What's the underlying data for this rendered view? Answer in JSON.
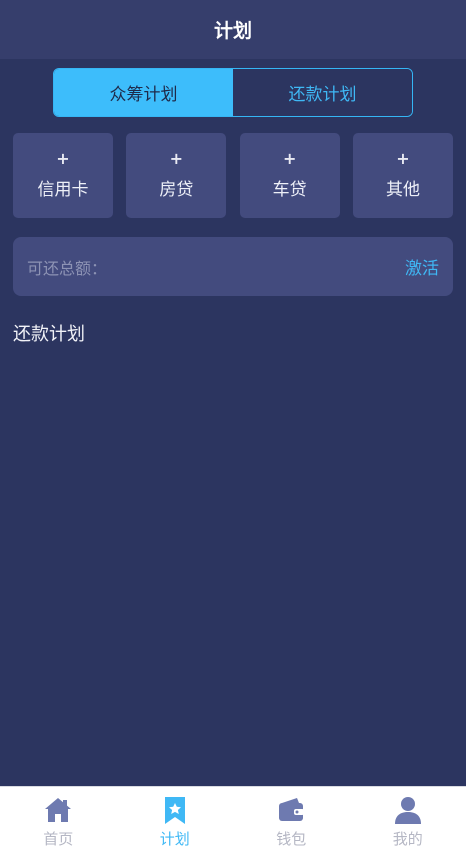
{
  "header": {
    "title": "计划"
  },
  "segment": {
    "tabs": [
      {
        "label": "众筹计划",
        "active": true
      },
      {
        "label": "还款计划",
        "active": false
      }
    ]
  },
  "categories": [
    {
      "plus": "+",
      "label": "信用卡"
    },
    {
      "plus": "+",
      "label": "房贷"
    },
    {
      "plus": "+",
      "label": "车贷"
    },
    {
      "plus": "+",
      "label": "其他"
    }
  ],
  "total": {
    "label": "可还总额：",
    "action": "激活"
  },
  "section": {
    "title": "还款计划"
  },
  "tabbar": {
    "items": [
      {
        "label": "首页",
        "icon": "home-icon",
        "active": false
      },
      {
        "label": "计划",
        "icon": "bookmark-star-icon",
        "active": true
      },
      {
        "label": "钱包",
        "icon": "wallet-icon",
        "active": false
      },
      {
        "label": "我的",
        "icon": "user-icon",
        "active": false
      }
    ]
  },
  "colors": {
    "background": "#2c3560",
    "header": "#363e6c",
    "card": "#434b7e",
    "accent": "#3fb8f5",
    "active_tab": "#3dbdfb",
    "icon_inactive": "#6e7ab0"
  }
}
